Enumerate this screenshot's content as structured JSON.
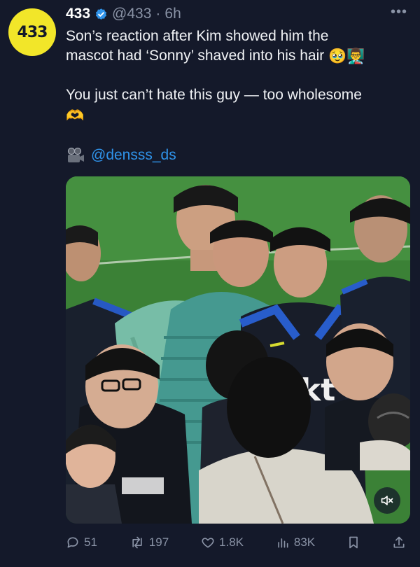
{
  "account": {
    "avatar_text": "433",
    "display_name": "433",
    "handle": "@433",
    "dot": "·",
    "time": "6h",
    "verified_icon": "verified-badge-icon"
  },
  "tweet": {
    "line1": "Son’s reaction after Kim showed him the",
    "line2": "mascot had ‘Sonny’ shaved into his hair",
    "line2_emojis": "🥹👨‍🏫",
    "line3": "You just can’t hate this guy — too wholesome",
    "line4_emoji": "🫶"
  },
  "credit": {
    "icon": "video-camera-icon",
    "handle": "@densss_ds"
  },
  "media": {
    "jersey_text": "kt",
    "mute_icon": "speaker-muted-icon"
  },
  "actions": {
    "replies": "51",
    "reposts": "197",
    "likes": "1.8K",
    "views": "83K"
  },
  "colors": {
    "background": "#14192a",
    "accent_link": "#2f93ea",
    "brand_yellow": "#f2e629",
    "muted_text": "#8a93a6"
  }
}
